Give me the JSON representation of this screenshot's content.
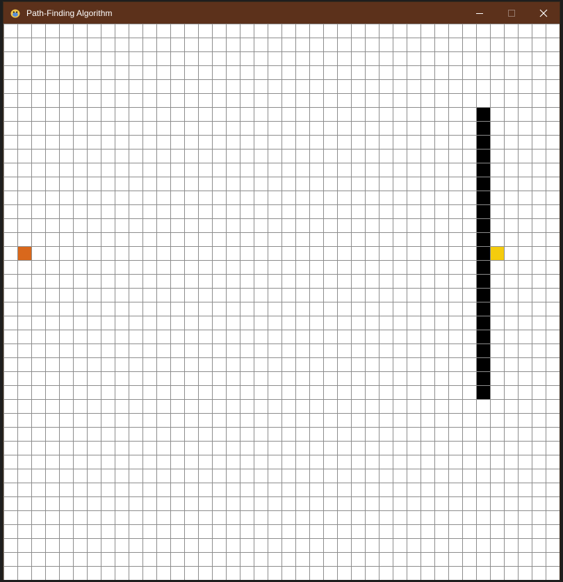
{
  "window": {
    "title": "Path-Finding Algorithm",
    "app_icon": "python-snake-icon",
    "controls": [
      "minimize-icon",
      "maximize-icon",
      "close-icon"
    ]
  },
  "grid": {
    "rows": 40,
    "cols": 40,
    "colors": {
      "line": "#8c8c8c",
      "empty": "#ffffff",
      "barrier": "#000000",
      "start": "#d9681c",
      "end": "#f5cc0d"
    },
    "start": {
      "row": 16,
      "col": 1
    },
    "end": {
      "row": 16,
      "col": 35
    },
    "barriers": [
      {
        "row": 6,
        "col": 34
      },
      {
        "row": 7,
        "col": 34
      },
      {
        "row": 8,
        "col": 34
      },
      {
        "row": 9,
        "col": 34
      },
      {
        "row": 10,
        "col": 34
      },
      {
        "row": 11,
        "col": 34
      },
      {
        "row": 12,
        "col": 34
      },
      {
        "row": 13,
        "col": 34
      },
      {
        "row": 14,
        "col": 34
      },
      {
        "row": 15,
        "col": 34
      },
      {
        "row": 16,
        "col": 34
      },
      {
        "row": 17,
        "col": 34
      },
      {
        "row": 18,
        "col": 34
      },
      {
        "row": 19,
        "col": 34
      },
      {
        "row": 20,
        "col": 34
      },
      {
        "row": 21,
        "col": 34
      },
      {
        "row": 22,
        "col": 34
      },
      {
        "row": 23,
        "col": 34
      },
      {
        "row": 24,
        "col": 34
      },
      {
        "row": 25,
        "col": 34
      },
      {
        "row": 26,
        "col": 34
      }
    ]
  }
}
